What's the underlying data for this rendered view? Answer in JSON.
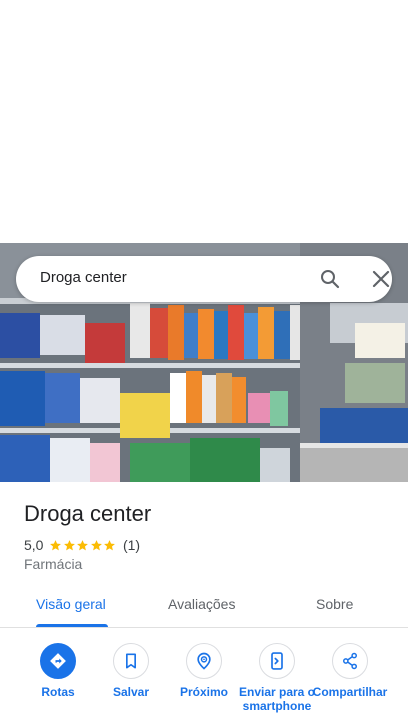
{
  "search": {
    "query": "Droga center"
  },
  "place": {
    "name": "Droga center",
    "rating": "5,0",
    "review_count": "(1)",
    "stars": 5,
    "category": "Farmácia"
  },
  "tabs": [
    {
      "label": "Visão geral",
      "active": true
    },
    {
      "label": "Avaliações",
      "active": false
    },
    {
      "label": "Sobre",
      "active": false
    }
  ],
  "actions": [
    {
      "label": "Rotas",
      "icon": "directions-icon"
    },
    {
      "label": "Salvar",
      "icon": "bookmark-icon"
    },
    {
      "label": "Próximo",
      "icon": "nearby-icon"
    },
    {
      "label": "Enviar para o smartphone",
      "icon": "send-to-phone-icon"
    },
    {
      "label": "Compartilhar",
      "icon": "share-icon"
    }
  ],
  "colors": {
    "accent": "#1a73e8",
    "star": "#fbbc04",
    "text": "#202124",
    "muted": "#70757a"
  }
}
